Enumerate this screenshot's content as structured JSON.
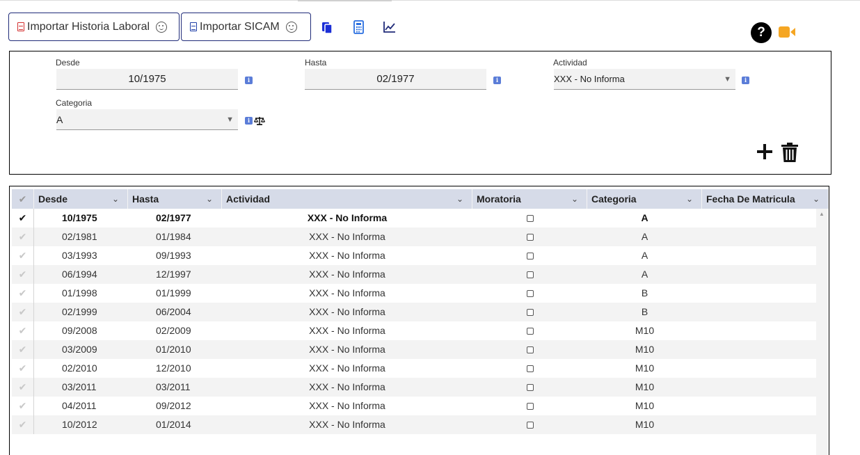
{
  "toolbar": {
    "import_historia_label": "Importar Historia Laboral",
    "import_sicam_label": "Importar SICAM",
    "icons": [
      "copy-icon",
      "calculator-icon",
      "chart-line-icon"
    ],
    "accent_blue": "#1f3fa8",
    "video_color": "#f5a623"
  },
  "form": {
    "desde": {
      "label": "Desde",
      "value": "10/1975"
    },
    "hasta": {
      "label": "Hasta",
      "value": "02/1977"
    },
    "actividad": {
      "label": "Actividad",
      "value": "XXX - No Informa"
    },
    "categoria": {
      "label": "Categoria",
      "value": "A"
    },
    "info_glyph": "i",
    "caret_glyph": "▼"
  },
  "grid": {
    "columns": [
      {
        "label": "Desde"
      },
      {
        "label": "Hasta"
      },
      {
        "label": "Actividad"
      },
      {
        "label": "Moratoria"
      },
      {
        "label": "Categoria"
      },
      {
        "label": "Fecha De Matricula"
      }
    ],
    "chevron_glyph": "⌄",
    "check_glyph": "✔",
    "rows": [
      {
        "desde": "10/1975",
        "hasta": "02/1977",
        "actividad": "XXX - No Informa",
        "moratoria": false,
        "categoria": "A",
        "fecha_matricula": "",
        "selected": true
      },
      {
        "desde": "02/1981",
        "hasta": "01/1984",
        "actividad": "XXX - No Informa",
        "moratoria": false,
        "categoria": "A",
        "fecha_matricula": "",
        "selected": false
      },
      {
        "desde": "03/1993",
        "hasta": "09/1993",
        "actividad": "XXX - No Informa",
        "moratoria": false,
        "categoria": "A",
        "fecha_matricula": "",
        "selected": false
      },
      {
        "desde": "06/1994",
        "hasta": "12/1997",
        "actividad": "XXX - No Informa",
        "moratoria": false,
        "categoria": "A",
        "fecha_matricula": "",
        "selected": false
      },
      {
        "desde": "01/1998",
        "hasta": "01/1999",
        "actividad": "XXX - No Informa",
        "moratoria": false,
        "categoria": "B",
        "fecha_matricula": "",
        "selected": false
      },
      {
        "desde": "02/1999",
        "hasta": "06/2004",
        "actividad": "XXX - No Informa",
        "moratoria": false,
        "categoria": "B",
        "fecha_matricula": "",
        "selected": false
      },
      {
        "desde": "09/2008",
        "hasta": "02/2009",
        "actividad": "XXX - No Informa",
        "moratoria": false,
        "categoria": "M10",
        "fecha_matricula": "",
        "selected": false
      },
      {
        "desde": "03/2009",
        "hasta": "01/2010",
        "actividad": "XXX - No Informa",
        "moratoria": false,
        "categoria": "M10",
        "fecha_matricula": "",
        "selected": false
      },
      {
        "desde": "02/2010",
        "hasta": "12/2010",
        "actividad": "XXX - No Informa",
        "moratoria": false,
        "categoria": "M10",
        "fecha_matricula": "",
        "selected": false
      },
      {
        "desde": "03/2011",
        "hasta": "03/2011",
        "actividad": "XXX - No Informa",
        "moratoria": false,
        "categoria": "M10",
        "fecha_matricula": "",
        "selected": false
      },
      {
        "desde": "04/2011",
        "hasta": "09/2012",
        "actividad": "XXX - No Informa",
        "moratoria": false,
        "categoria": "M10",
        "fecha_matricula": "",
        "selected": false
      },
      {
        "desde": "10/2012",
        "hasta": "01/2014",
        "actividad": "XXX - No Informa",
        "moratoria": false,
        "categoria": "M10",
        "fecha_matricula": "",
        "selected": false
      }
    ]
  }
}
